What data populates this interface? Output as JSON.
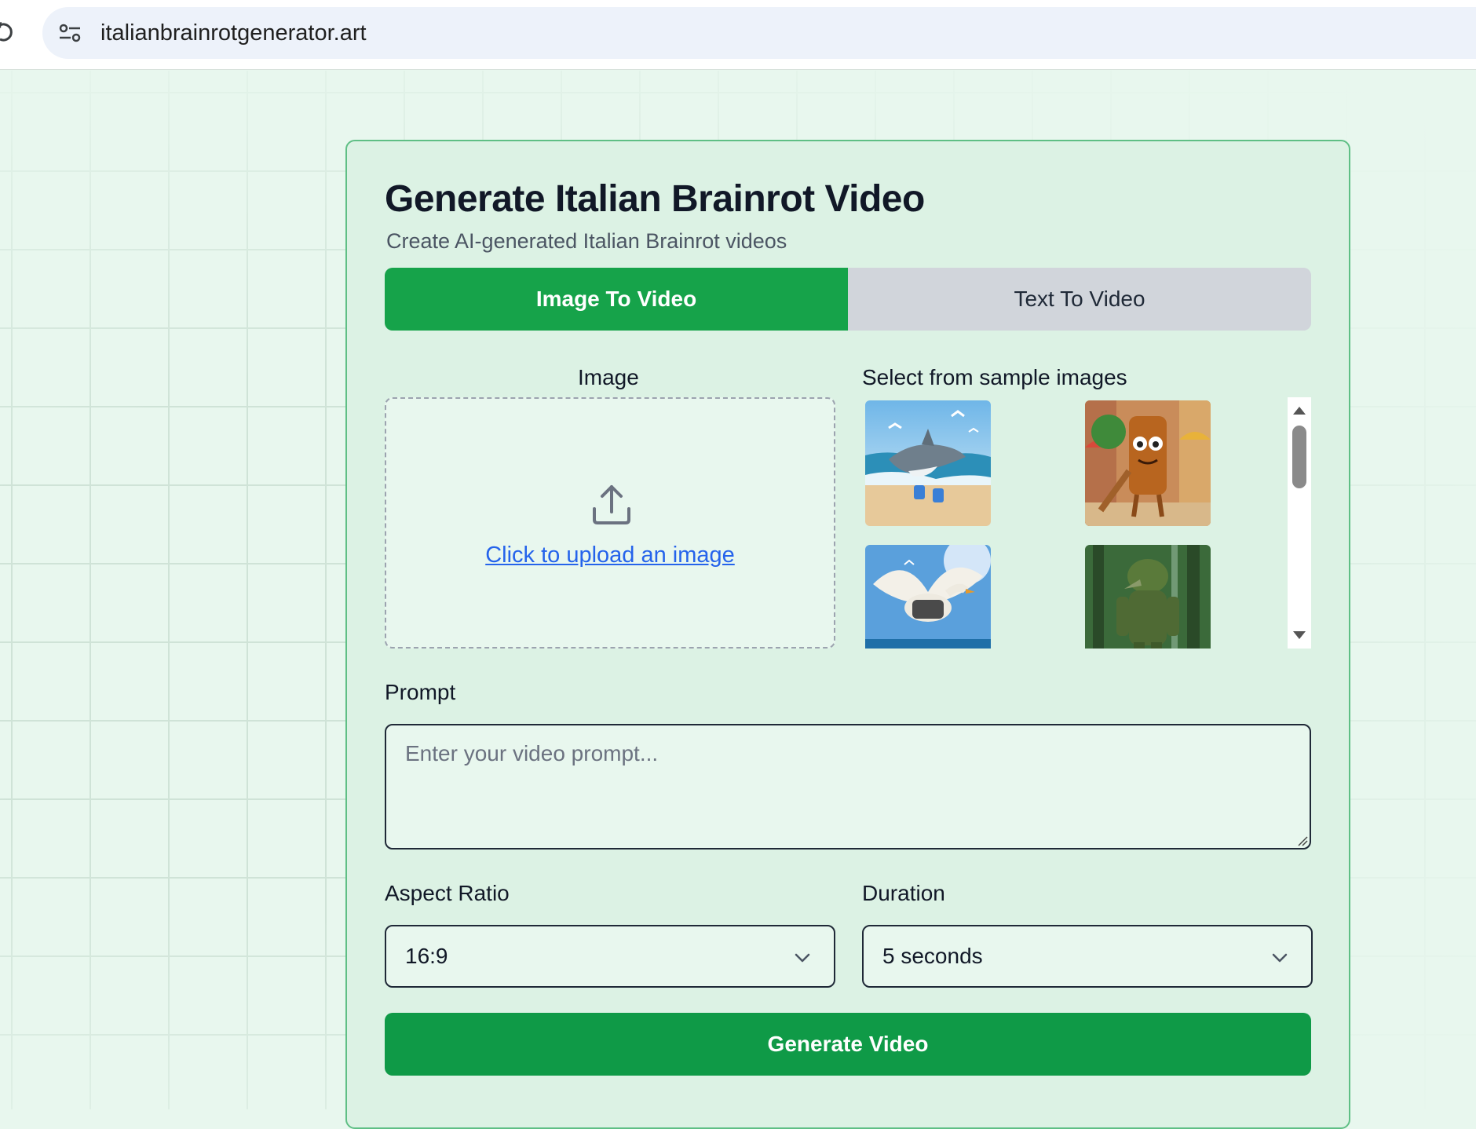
{
  "browser": {
    "url": "italianbrainrotgenerator.art"
  },
  "card": {
    "title": "Generate Italian Brainrot Video",
    "subtitle": "Create AI-generated Italian Brainrot videos"
  },
  "tabs": [
    {
      "label": "Image To Video",
      "active": true
    },
    {
      "label": "Text To Video",
      "active": false
    }
  ],
  "image_section": {
    "label": "Image",
    "upload_link": "Click to upload an image"
  },
  "samples_section": {
    "label": "Select from sample images",
    "images": [
      {
        "icon": "shark-sneakers-beach-image"
      },
      {
        "icon": "wooden-log-character-street-image"
      },
      {
        "icon": "goose-bomber-ocean-image"
      },
      {
        "icon": "tree-creature-forest-image"
      }
    ]
  },
  "prompt": {
    "label": "Prompt",
    "placeholder": "Enter your video prompt...",
    "value": ""
  },
  "aspect_ratio": {
    "label": "Aspect Ratio",
    "selected": "16:9"
  },
  "duration": {
    "label": "Duration",
    "selected": "5 seconds"
  },
  "generate_button": {
    "label": "Generate Video"
  },
  "colors": {
    "primary_green": "#16a34a",
    "button_green": "#0f9a47",
    "card_bg": "#dcf2e4",
    "link_blue": "#2563eb"
  }
}
